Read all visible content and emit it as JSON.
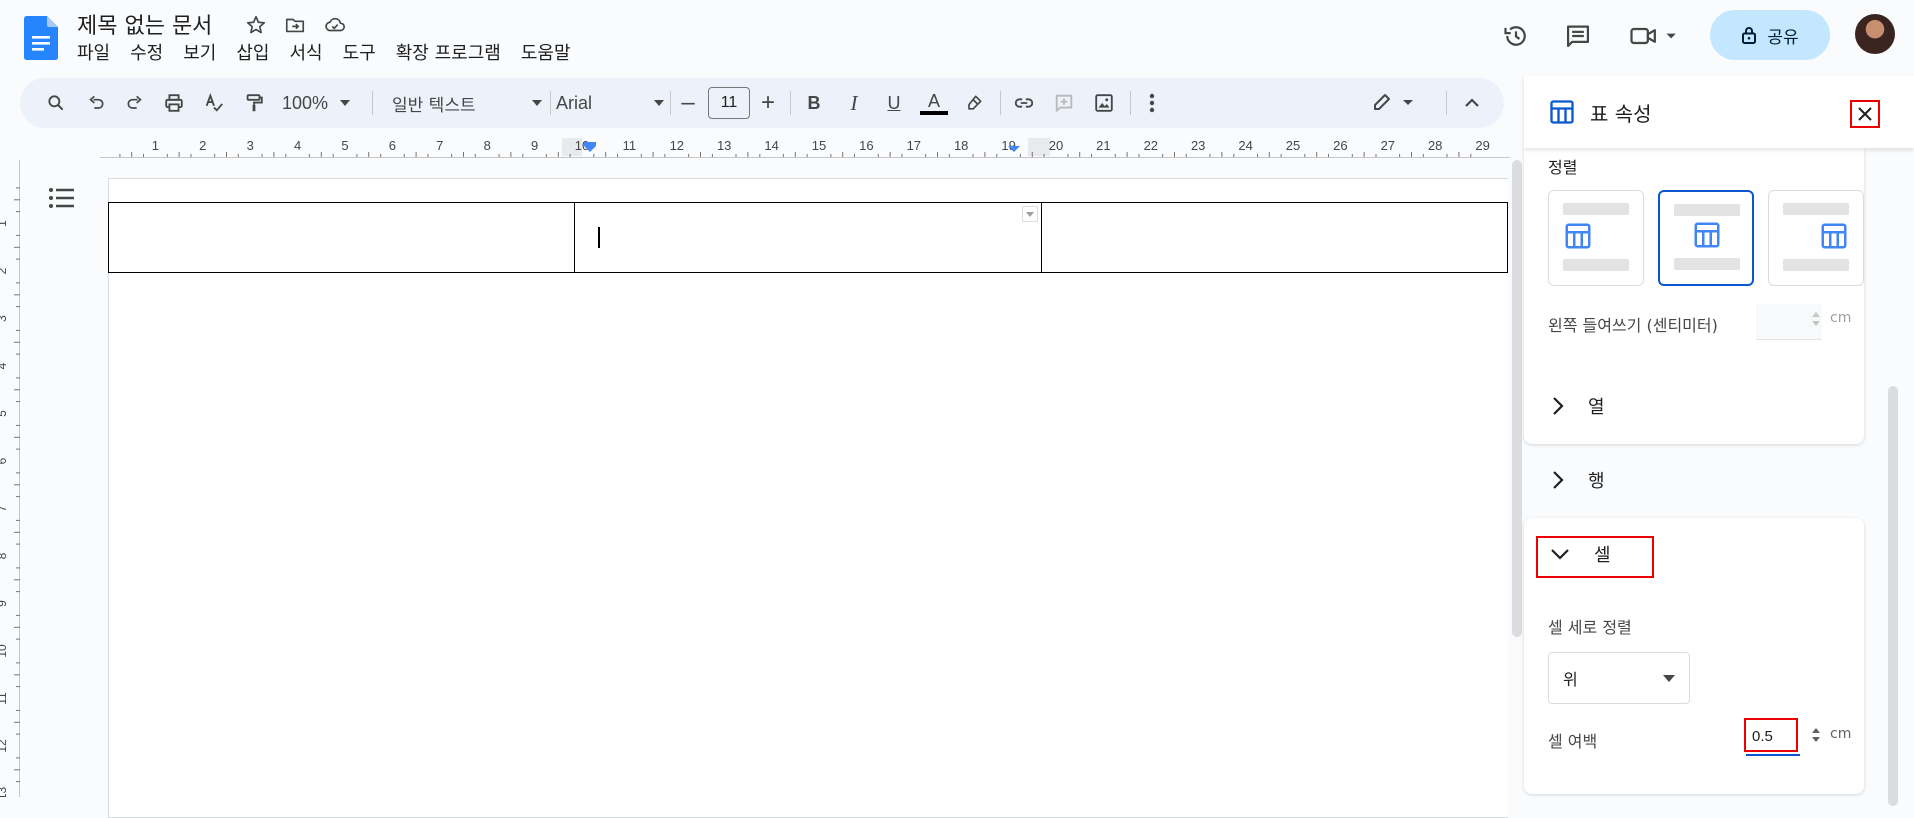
{
  "app": {
    "doc_title": "제목 없는 문서",
    "menu": [
      "파일",
      "수정",
      "보기",
      "삽입",
      "서식",
      "도구",
      "확장 프로그램",
      "도움말"
    ],
    "share_label": "공유"
  },
  "toolbar": {
    "zoom": "100%",
    "style": "일반 텍스트",
    "font": "Arial",
    "font_size": "11",
    "minus": "–",
    "plus": "+",
    "bold": "B",
    "italic": "I",
    "underline": "U",
    "text_color": "A",
    "text_color_value": "#000000"
  },
  "ruler": {
    "labels": [
      "1",
      "2",
      "3",
      "4",
      "5",
      "6",
      "7",
      "8",
      "9",
      "10",
      "11",
      "12",
      "13",
      "14",
      "15",
      "16",
      "17",
      "18",
      "19",
      "20",
      "21",
      "22",
      "23",
      "24",
      "25",
      "26",
      "27",
      "28",
      "29"
    ],
    "left_labels": [
      "1",
      "2",
      "3",
      "4",
      "5",
      "6",
      "7",
      "8",
      "9",
      "10",
      "11",
      "12",
      "13"
    ]
  },
  "panel": {
    "title": "표 속성",
    "alignment_label": "정렬",
    "alignment_selected": "center",
    "left_indent_label": "왼쪽 들여쓰기 (센티미터)",
    "left_indent_value": "",
    "unit": "cm",
    "sections": {
      "column": "열",
      "row": "행",
      "cell": "셀"
    },
    "cell_vertical_align_label": "셀 세로 정렬",
    "cell_vertical_align_value": "위",
    "cell_padding_label": "셀 여백",
    "cell_padding_value": "0.5"
  },
  "colors": {
    "accent": "#0b57d0",
    "share_bg": "#c2e7ff",
    "highlight": "#ee0000"
  }
}
